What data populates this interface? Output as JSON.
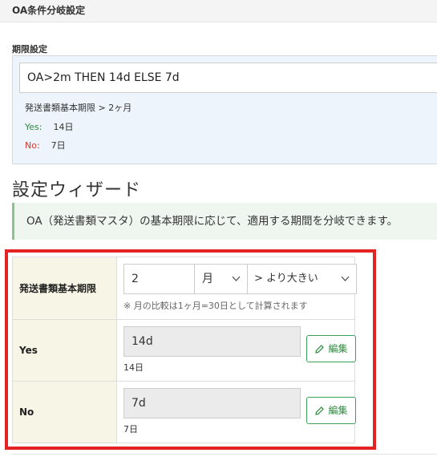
{
  "header": {
    "title": "OA条件分岐設定"
  },
  "period": {
    "label": "期限設定",
    "expression": "OA>2m THEN 14d ELSE 7d",
    "condition": "発送書類基本期限 > 2ヶ月",
    "yes_key": "Yes:",
    "yes_value": "14日",
    "no_key": "No:",
    "no_value": "7日"
  },
  "wizard": {
    "title": "設定ウィザード",
    "info": "OA（発送書類マスタ）の基本期限に応じて、適用する期間を分岐できます。"
  },
  "form": {
    "rows": [
      {
        "label": "発送書類基本期限",
        "number_value": "2",
        "unit_value": "月",
        "comparator_value": "> より大きい",
        "hint": "※ 月の比較は1ヶ月=30日として計算されます"
      },
      {
        "label": "Yes",
        "value": "14d",
        "sub": "14日",
        "edit_label": "編集"
      },
      {
        "label": "No",
        "value": "7d",
        "sub": "7日",
        "edit_label": "編集"
      }
    ]
  },
  "icons": {
    "edit": "pencil-icon",
    "dropdown": "chevron-down-icon"
  },
  "colors": {
    "yes": "#2e8b3e",
    "no": "#d03a2e",
    "highlight_frame": "#e32222"
  }
}
